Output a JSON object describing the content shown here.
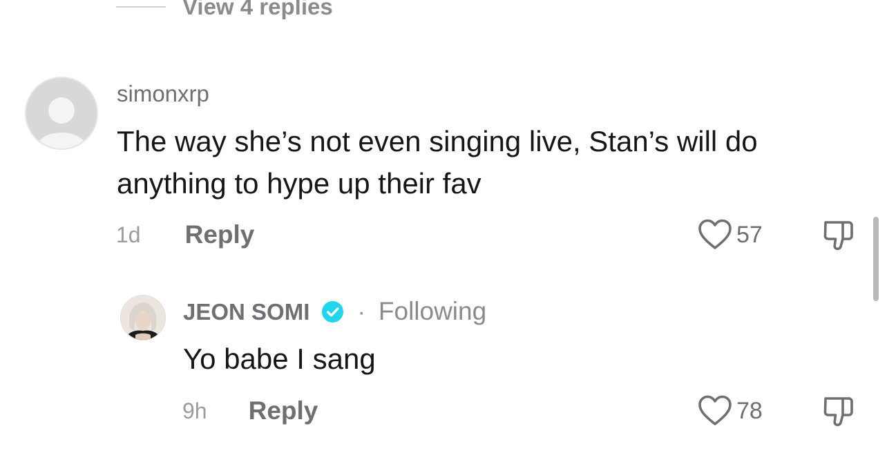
{
  "view_replies": {
    "label": "View 4 replies"
  },
  "comments": [
    {
      "username": "simonxrp",
      "text_line1": "The way she’s not even singing live, Stan’s will do",
      "text_line2": "anything to hype up their fav",
      "time": "1d",
      "reply_label": "Reply",
      "likes": "57"
    },
    {
      "username": "JEON SOMI",
      "verified": true,
      "separator": "·",
      "follow_status": "Following",
      "text": "Yo babe I sang",
      "time": "9h",
      "reply_label": "Reply",
      "likes": "78"
    }
  ],
  "colors": {
    "verified_badge": "#20d5ec",
    "muted_text": "#6e6e73",
    "body_text": "#161616"
  },
  "icons": {
    "like": "heart-outline-icon",
    "dislike": "thumbs-down-icon",
    "verified": "verified-check-icon",
    "default_avatar": "default-user-avatar-icon"
  }
}
